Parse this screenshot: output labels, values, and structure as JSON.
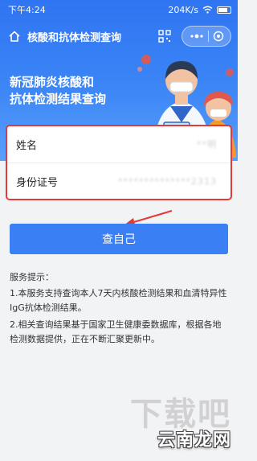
{
  "status_bar": {
    "time": "下午4:24",
    "speed": "204K/s"
  },
  "header": {
    "title": "核酸和抗体检测查询"
  },
  "hero": {
    "line1": "新冠肺炎核酸和",
    "line2": "抗体检测结果查询"
  },
  "form": {
    "name_label": "姓名",
    "name_value": "**明",
    "id_label": "身份证号",
    "id_value": "**************2313"
  },
  "query_button": "查自己",
  "notice": {
    "title": "服务提示：",
    "item1": "1.本服务支持查询本人7天内核酸检测结果和血清特异性IgG抗体检测结果。",
    "item2": "2.相关查询结果基于国家卫生健康委数据库，根据各地检测数据提供，正在不断汇聚更新中。"
  },
  "watermark": {
    "top": "下载吧",
    "bottom": "云南龙网"
  },
  "colors": {
    "primary": "#3b7ff5",
    "highlight_border": "#e53935"
  }
}
